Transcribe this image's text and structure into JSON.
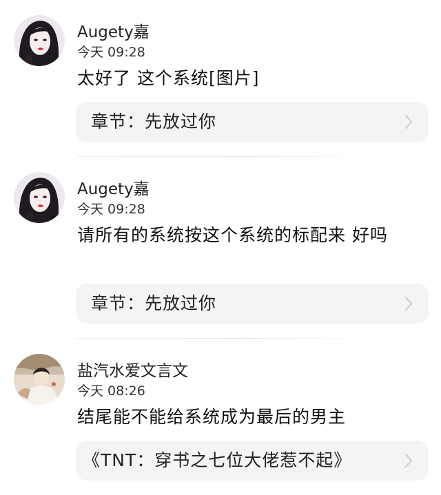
{
  "comments": [
    {
      "avatar_icon": "user-avatar-portrait",
      "username": "Augety嘉",
      "time": "今天 09:28",
      "text": "太好了 这个系统[图片]",
      "chapter": "章节：先放过你"
    },
    {
      "avatar_icon": "user-avatar-portrait",
      "username": "Augety嘉",
      "time": "今天 09:28",
      "text": "请所有的系统按这个系统的标配来 好吗",
      "chapter": "章节：先放过你"
    },
    {
      "avatar_icon": "user-avatar-photo",
      "username": "盐汽水爱文言文",
      "time": "今天 08:26",
      "text": "结尾能不能给系统成为最后的男主",
      "chapter": "《TNT：穿书之七位大佬惹不起》"
    }
  ],
  "colors": {
    "background": "#ffffff",
    "card": "#f4f4f4",
    "chevron": "#d0d0d0",
    "divider": "#e6e6e6"
  }
}
